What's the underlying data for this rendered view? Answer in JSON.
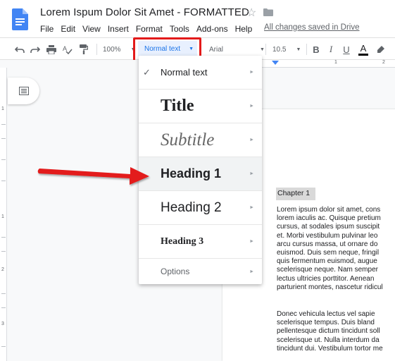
{
  "document": {
    "title": "Lorem Ispum Dolor Sit Amet - FORMATTED",
    "save_status": "All changes saved in Drive"
  },
  "menubar": {
    "items": [
      "File",
      "Edit",
      "View",
      "Insert",
      "Format",
      "Tools",
      "Add-ons",
      "Help"
    ]
  },
  "toolbar": {
    "zoom": "100%",
    "paragraph_style": "Normal text",
    "font": "Arial",
    "font_size": "10.5",
    "bold": "B",
    "italic": "I",
    "underline": "U",
    "text_color": "A"
  },
  "ruler": {
    "top_numbers": [
      "1",
      "2"
    ],
    "left_numbers": [
      "1",
      "1",
      "2",
      "3"
    ]
  },
  "style_menu": {
    "items": [
      {
        "label": "Normal text",
        "selected": true
      },
      {
        "label": "Title"
      },
      {
        "label": "Subtitle"
      },
      {
        "label": "Heading 1",
        "hovered": true
      },
      {
        "label": "Heading 2"
      },
      {
        "label": "Heading 3"
      },
      {
        "label": "Options"
      }
    ],
    "submenu_arrow": "►",
    "check_mark": "✓"
  },
  "page": {
    "heading": "Chapter 1",
    "paragraph1": [
      "Lorem ipsum dolor sit amet, cons",
      "lorem iaculis ac. Quisque pretium",
      "cursus, at sodales ipsum suscipit",
      "et. Morbi vestibulum pulvinar leo",
      "arcu cursus massa, ut ornare do",
      "euismod. Duis sem neque, fringil",
      "quis fermentum euismod, augue",
      "scelerisque neque. Nam semper",
      "lectus ultricies porttitor. Aenean",
      "parturient montes, nascetur ridicul"
    ],
    "paragraph2": [
      "Donec vehicula lectus vel sapie",
      "scelerisque tempus. Duis bland",
      "pellentesque dictum tincidunt soll",
      "scelerisque ut. Nulla interdum da",
      "tincidunt dui. Vestibulum tortor me"
    ]
  },
  "colors": {
    "accent": "#1a73e8",
    "highlight_red": "#e31a1a",
    "doc_blue": "#4285f4",
    "heading_bg": "#d9d9d9"
  }
}
